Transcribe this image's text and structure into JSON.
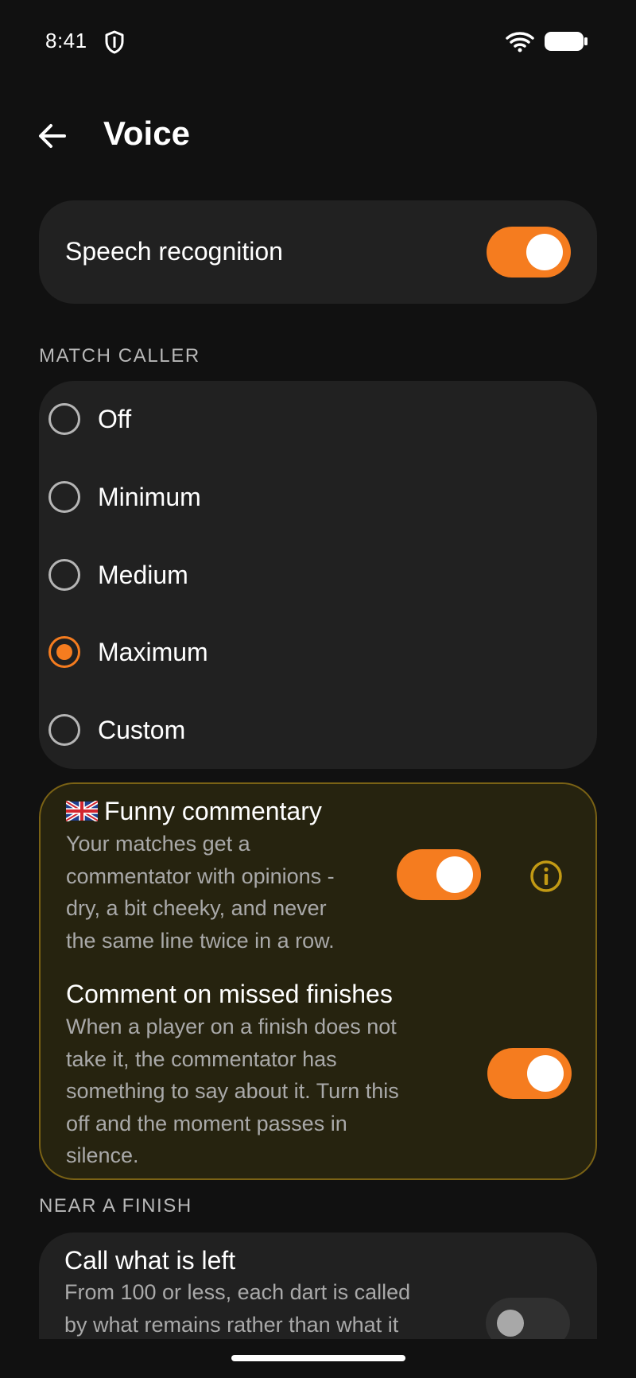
{
  "status_bar": {
    "time": "8:41",
    "icons": [
      "shield-icon",
      "wifi-icon",
      "battery-icon"
    ]
  },
  "app_bar": {
    "back_icon": "arrow-left-icon",
    "title": "Voice"
  },
  "speech_recognition": {
    "label": "Speech recognition",
    "enabled": true
  },
  "match_caller": {
    "header": "MATCH CALLER",
    "options": [
      {
        "label": "Off",
        "selected": false
      },
      {
        "label": "Minimum",
        "selected": false
      },
      {
        "label": "Medium",
        "selected": false
      },
      {
        "label": "Maximum",
        "selected": true
      },
      {
        "label": "Custom",
        "selected": false
      }
    ]
  },
  "commentary": {
    "funny": {
      "flag_icon": "uk-flag-icon",
      "title": "Funny commentary",
      "description_lines": [
        "Your matches get a",
        "commentator with opinions -",
        "dry, a bit cheeky, and never",
        "the same line twice in a row."
      ],
      "enabled": true,
      "info_icon": "info-icon"
    },
    "missed_finishes": {
      "title": "Comment on missed finishes",
      "description_lines": [
        "When a player on a finish does not",
        "take it, the commentator has",
        "something to say about it. Turn this",
        "off and the moment passes in",
        "silence."
      ],
      "enabled": true
    }
  },
  "near_finish": {
    "header": "NEAR A FINISH",
    "call_left": {
      "title": "Call what is left",
      "description_lines": [
        "From 100 or less, each dart is called",
        "by what remains rather than what it"
      ],
      "enabled": false
    }
  },
  "colors": {
    "accent": "#f57c1f",
    "background": "#111111",
    "card": "#212121",
    "highlight_card": "#26230f",
    "highlight_border": "#7a6215",
    "info": "#c29a14"
  }
}
